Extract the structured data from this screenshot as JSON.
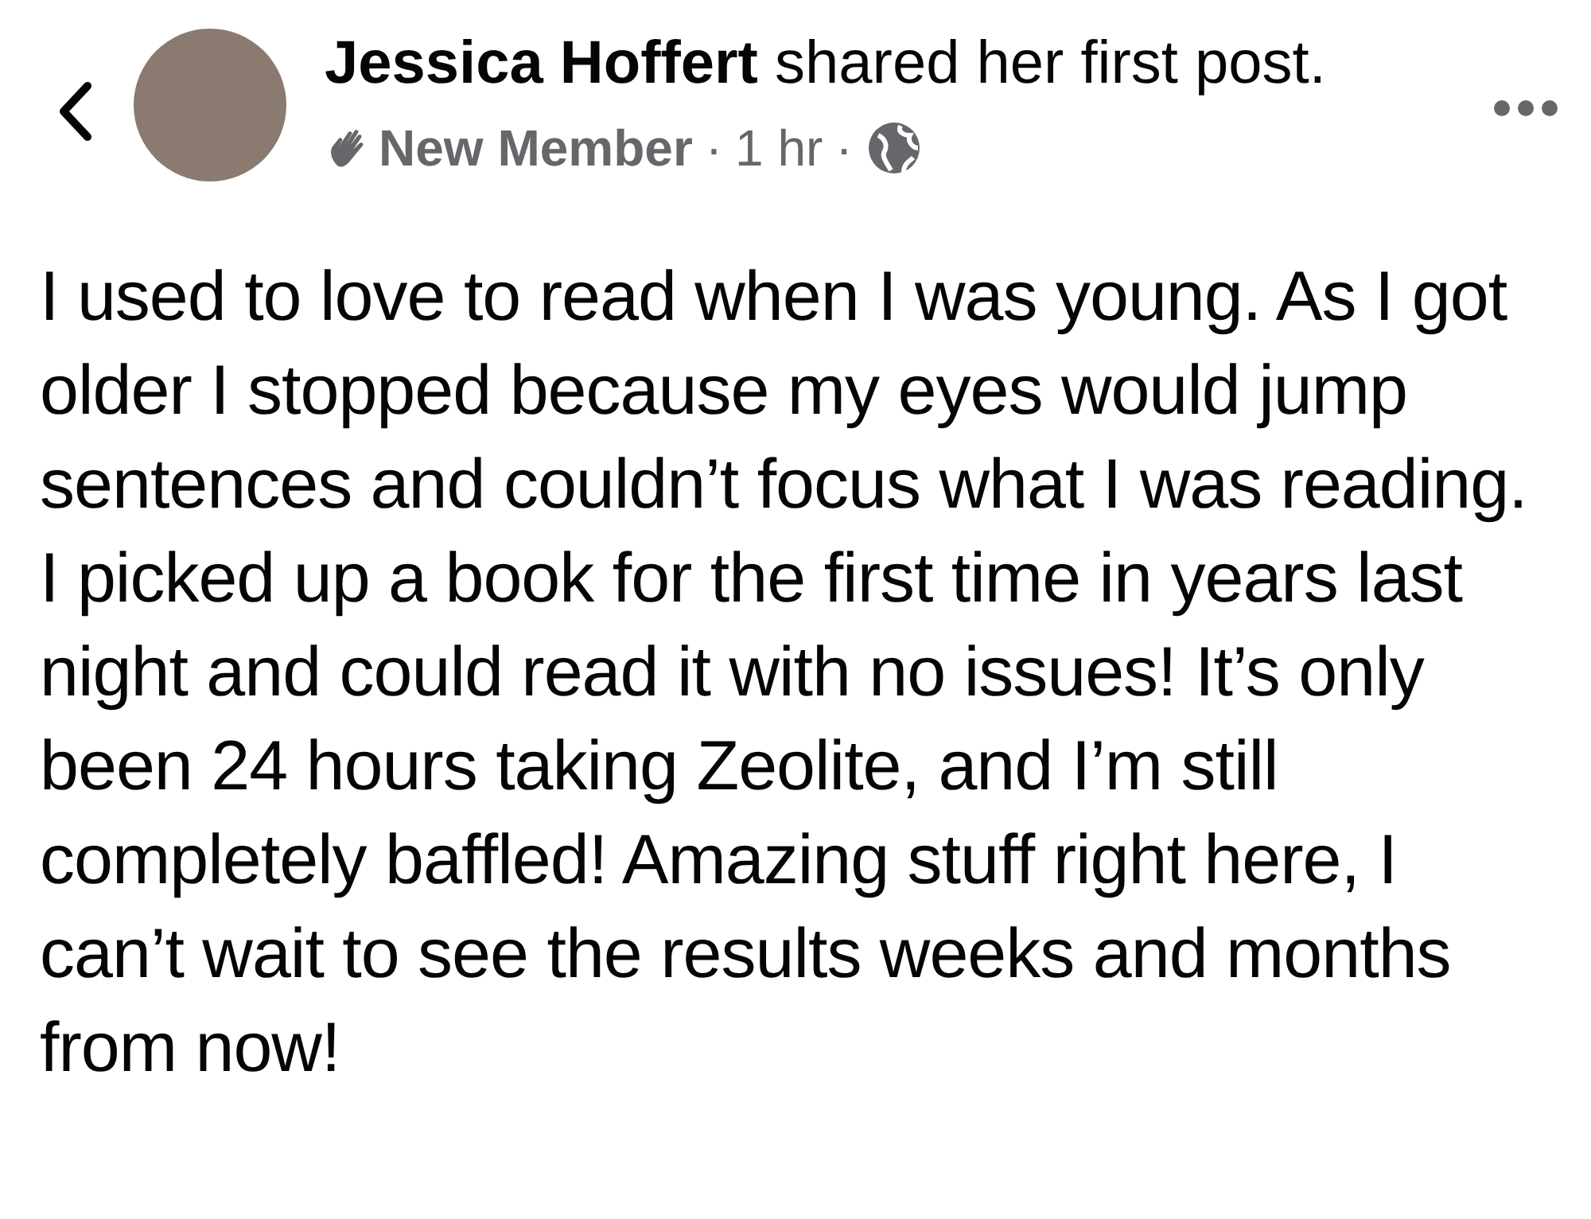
{
  "post": {
    "headline": "**Jessica Hoffert** shared her first post.",
    "meta": [
      {
        "kind": "badge",
        "text": "New Member"
      },
      {
        "kind": "separator",
        "text": "·"
      },
      {
        "kind": "time",
        "text": "1 hr"
      },
      {
        "kind": "separator",
        "text": "·"
      },
      {
        "kind": "audience"
      }
    ],
    "body": "I used to love to read when I was young. As I got older I stopped because my eyes would jump sentences and couldn’t focus what I was reading. I picked up a book for the first time in years last night and could read it with no issues! It’s only been 24 hours taking Zeolite, and I’m still completely baffled! Amazing stuff right here, I can’t wait to see the results weeks and months from now!"
  }
}
